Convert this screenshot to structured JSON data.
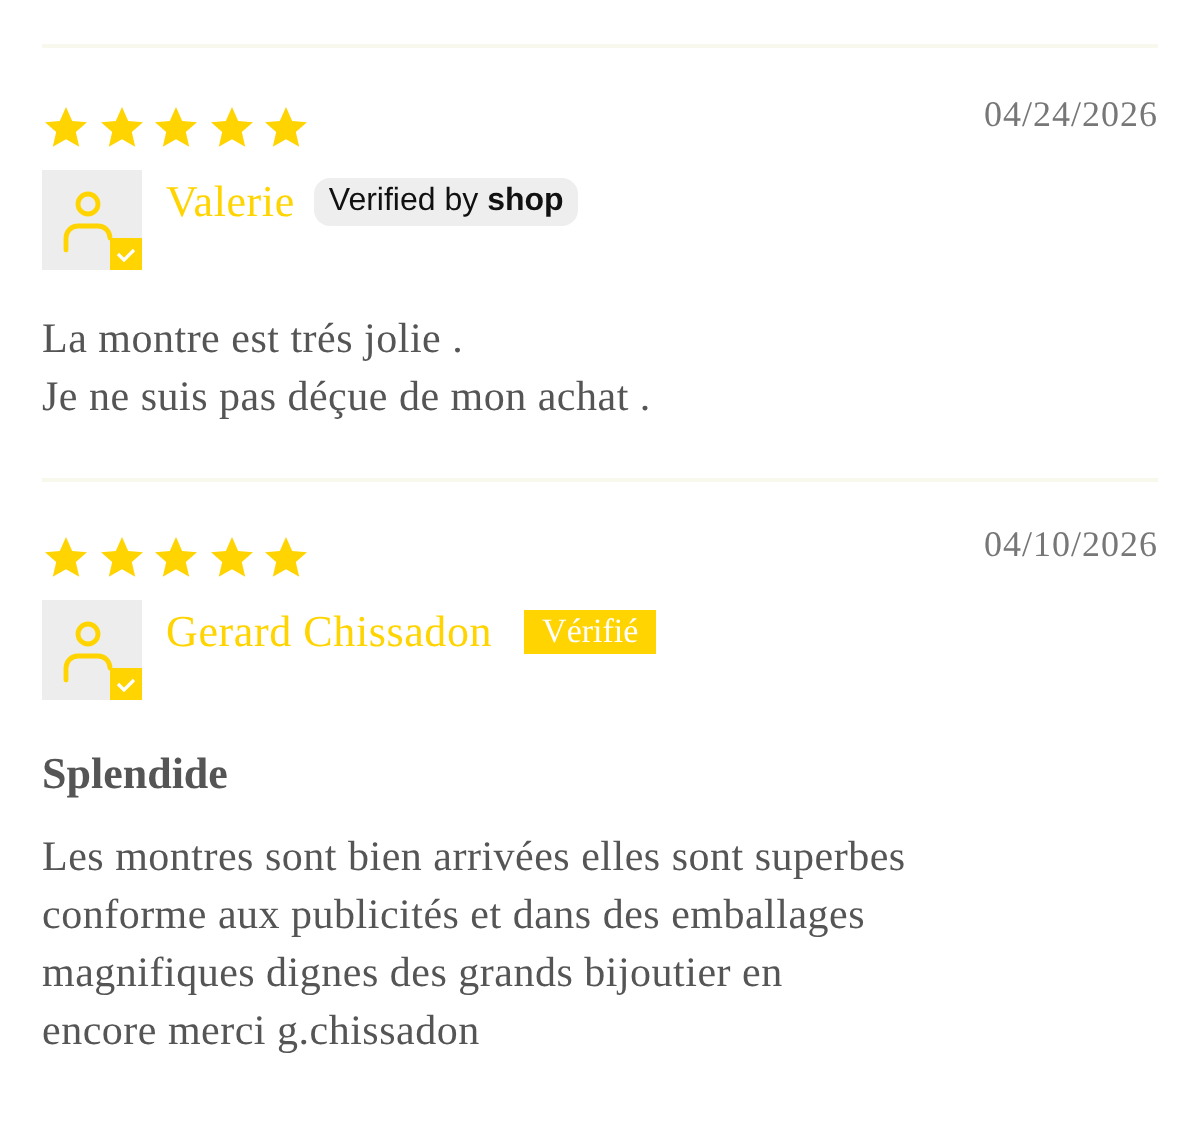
{
  "reviews": [
    {
      "stars": 5,
      "date": "04/24/2026",
      "author": "Valerie",
      "badge": {
        "kind": "shop",
        "text": "Verified by **shop**"
      },
      "body": [
        "La montre est trés jolie .",
        "Je ne suis pas déçue de mon achat ."
      ]
    },
    {
      "stars": 5,
      "date": "04/10/2026",
      "author": "Gerard Chissadon",
      "badge": {
        "kind": "plain",
        "text": "Vérifié"
      },
      "title": "Splendide",
      "body": [
        "Les montres sont bien arrivées elles sont superbes",
        "conforme aux publicités et dans des emballages",
        "magnifiques dignes des grands bijoutier en",
        "encore merci g.chissadon"
      ]
    }
  ]
}
